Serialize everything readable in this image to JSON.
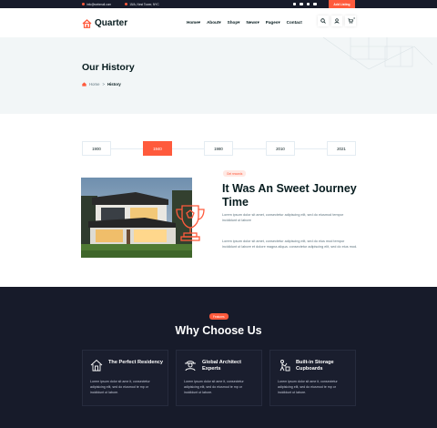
{
  "topbar": {
    "email": "info@webmail.com",
    "address": "15/A, Nest Tower, NYC",
    "add_listing": "Add Listing",
    "social_icons": [
      "facebook-icon",
      "twitter-icon",
      "instagram-icon",
      "dribbble-icon"
    ]
  },
  "header": {
    "logo": "Quarter",
    "nav": [
      "Home",
      "About",
      "Shop",
      "News",
      "Pages",
      "Contact"
    ],
    "cart_count": "0"
  },
  "breadcrumb": {
    "title": "Our History",
    "home": "Home",
    "separator": ">",
    "current": "History"
  },
  "timeline": {
    "years": [
      "1900",
      "1940",
      "1980",
      "2010",
      "2021"
    ],
    "active_index": 1
  },
  "history": {
    "badge": "Get rewards",
    "title": "It Was An Sweet Journey Time",
    "paragraph1": "Lorem ipsum dolor sit amet, consectetur adipiscing elit, sed do eiusmod tempor incididunt ut labore",
    "paragraph2": "Lorem ipsum dolor sit amet, consectetur adipiscing elit, sed do eius mod tempor incididunt ut labore et dolore magna aliqua. consectetur adipiscing elit, sed do eius mod."
  },
  "why": {
    "badge": "Features",
    "title": "Why Choose Us",
    "cards": [
      {
        "icon": "house-icon",
        "title": "The Perfect Residency",
        "text": "Lorem ipsum dolor sit ame it, consectetur adipisicing elit, sed do eiusmod te mp or incididunt ut labore."
      },
      {
        "icon": "architect-icon",
        "title": "Global Architect Experts",
        "text": "Lorem ipsum dolor sit ame it, consectetur adipisicing elit, sed do eiusmod te mp or incididunt ut labore."
      },
      {
        "icon": "storage-icon",
        "title": "Built-in Storage Cupboards",
        "text": "Lorem ipsum dolor sit ame it, consectetur adipisicing elit, sed do eiusmod te mp or incididunt ut labore."
      }
    ]
  },
  "colors": {
    "accent": "#ff5a3c",
    "dark": "#171b2a",
    "heading": "#071c1f",
    "band": "#f2f6f7"
  }
}
